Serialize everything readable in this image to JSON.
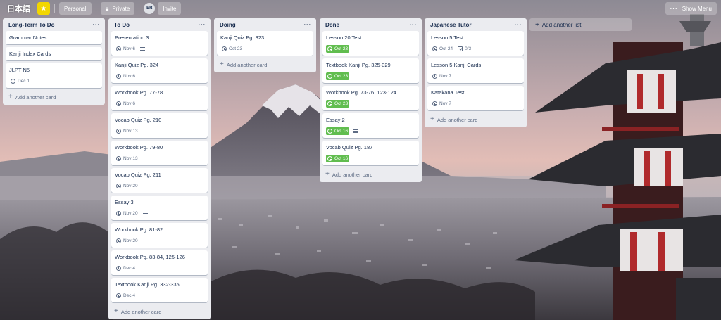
{
  "header": {
    "board_title": "日本語",
    "workspace_label": "Personal",
    "visibility_label": "Private",
    "member_initials": "ER",
    "invite_label": "Invite",
    "show_menu_label": "Show Menu"
  },
  "lists": [
    {
      "title": "Long-Term To Do",
      "cards": [
        {
          "title": "Grammar Notes"
        },
        {
          "title": "Kanji Index Cards"
        },
        {
          "title": "JLPT N5",
          "due": "Dec 1"
        }
      ]
    },
    {
      "title": "To Do",
      "cards": [
        {
          "title": "Presentation 3",
          "due": "Nov 6",
          "description": true
        },
        {
          "title": "Kanji Quiz Pg. 324",
          "due": "Nov 6"
        },
        {
          "title": "Workbook Pg. 77-78",
          "due": "Nov 6"
        },
        {
          "title": "Vocab Quiz Pg. 210",
          "due": "Nov 13"
        },
        {
          "title": "Workbook Pg. 79-80",
          "due": "Nov 13"
        },
        {
          "title": "Vocab Quiz Pg. 211",
          "due": "Nov 20"
        },
        {
          "title": "Essay 3",
          "due": "Nov 20",
          "description": true
        },
        {
          "title": "Workbook Pg. 81-82",
          "due": "Nov 20"
        },
        {
          "title": "Workbook Pg. 83-84, 125-126",
          "due": "Dec 4"
        },
        {
          "title": "Textbook Kanji Pg. 332-335",
          "due": "Dec 4"
        }
      ]
    },
    {
      "title": "Doing",
      "cards": [
        {
          "title": "Kanji Quiz Pg. 323",
          "due": "Oct 23"
        }
      ]
    },
    {
      "title": "Done",
      "cards": [
        {
          "title": "Lesson 20 Test",
          "due": "Oct 23",
          "complete": true
        },
        {
          "title": "Textbook Kanji Pg. 325-329",
          "due": "Oct 23",
          "complete": true
        },
        {
          "title": "Workbook Pg. 73-76, 123-124",
          "due": "Oct 23",
          "complete": true
        },
        {
          "title": "Essay 2",
          "due": "Oct 16",
          "complete": true,
          "description": true
        },
        {
          "title": "Vocab Quiz Pg. 187",
          "due": "Oct 16",
          "complete": true
        }
      ]
    },
    {
      "title": "Japanese Tutor",
      "cards": [
        {
          "title": "Lesson 5 Test",
          "due": "Oct 24",
          "checklist": "0/3"
        },
        {
          "title": "Lesson 5 Kanji Cards",
          "due": "Nov 7"
        },
        {
          "title": "Katakana Test",
          "due": "Nov 7"
        }
      ]
    }
  ],
  "add_card_label": "Add another card",
  "add_list_label": "Add another list",
  "list_menu_glyph": "···",
  "colors": {
    "list_bg": "#ebecf0",
    "done_badge": "#61bd4f",
    "star": "#f2d600"
  }
}
